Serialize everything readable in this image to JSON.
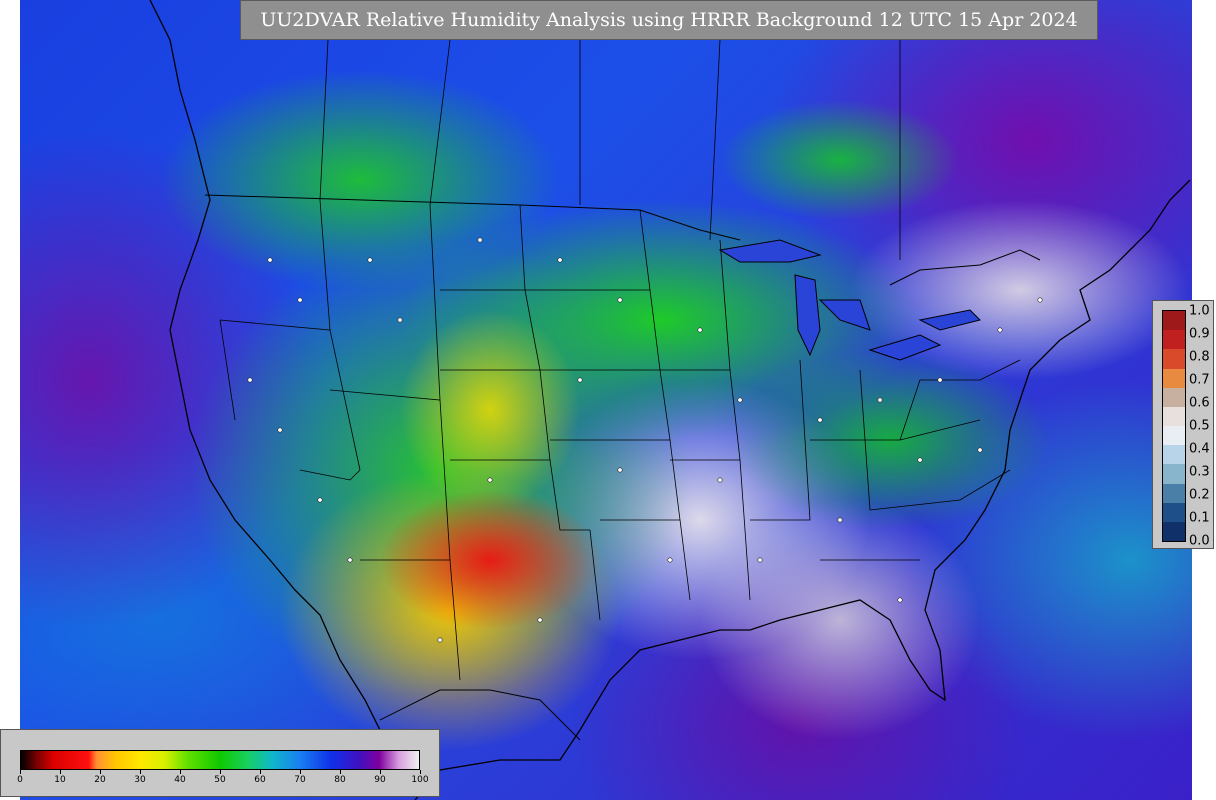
{
  "title": "UU2DVAR Relative Humidity Analysis using HRRR Background 12 UTC 15 Apr 2024",
  "colorbar": {
    "tick_labels": [
      "0",
      "10",
      "20",
      "30",
      "40",
      "50",
      "60",
      "70",
      "80",
      "90",
      "100"
    ],
    "stops": [
      {
        "value": 0,
        "color": "#000000"
      },
      {
        "value": 4,
        "color": "#7a0000"
      },
      {
        "value": 8,
        "color": "#d80000"
      },
      {
        "value": 17,
        "color": "#ff1010"
      },
      {
        "value": 19,
        "color": "#ff9030"
      },
      {
        "value": 24,
        "color": "#ffc800"
      },
      {
        "value": 30,
        "color": "#ffe800"
      },
      {
        "value": 36,
        "color": "#d8f000"
      },
      {
        "value": 42,
        "color": "#60e000"
      },
      {
        "value": 50,
        "color": "#10c800"
      },
      {
        "value": 57,
        "color": "#18d060"
      },
      {
        "value": 63,
        "color": "#10b8c8"
      },
      {
        "value": 70,
        "color": "#1880f0"
      },
      {
        "value": 78,
        "color": "#1030e8"
      },
      {
        "value": 85,
        "color": "#4010c0"
      },
      {
        "value": 90,
        "color": "#8000a0"
      },
      {
        "value": 95,
        "color": "#d8a0e0"
      },
      {
        "value": 100,
        "color": "#f0f0f0"
      }
    ]
  },
  "increment_legend": {
    "labels": [
      "1.0",
      "0.9",
      "0.8",
      "0.7",
      "0.6",
      "0.5",
      "0.4",
      "0.3",
      "0.2",
      "0.1",
      "0.0"
    ],
    "colors": [
      "#9e1a1a",
      "#c02020",
      "#d84a2a",
      "#e88a40",
      "#c8b0a0",
      "#e8e0dc",
      "#e8eef4",
      "#b8d4e8",
      "#88b4cc",
      "#4a80a8",
      "#1f4f88",
      "#10306a"
    ]
  }
}
